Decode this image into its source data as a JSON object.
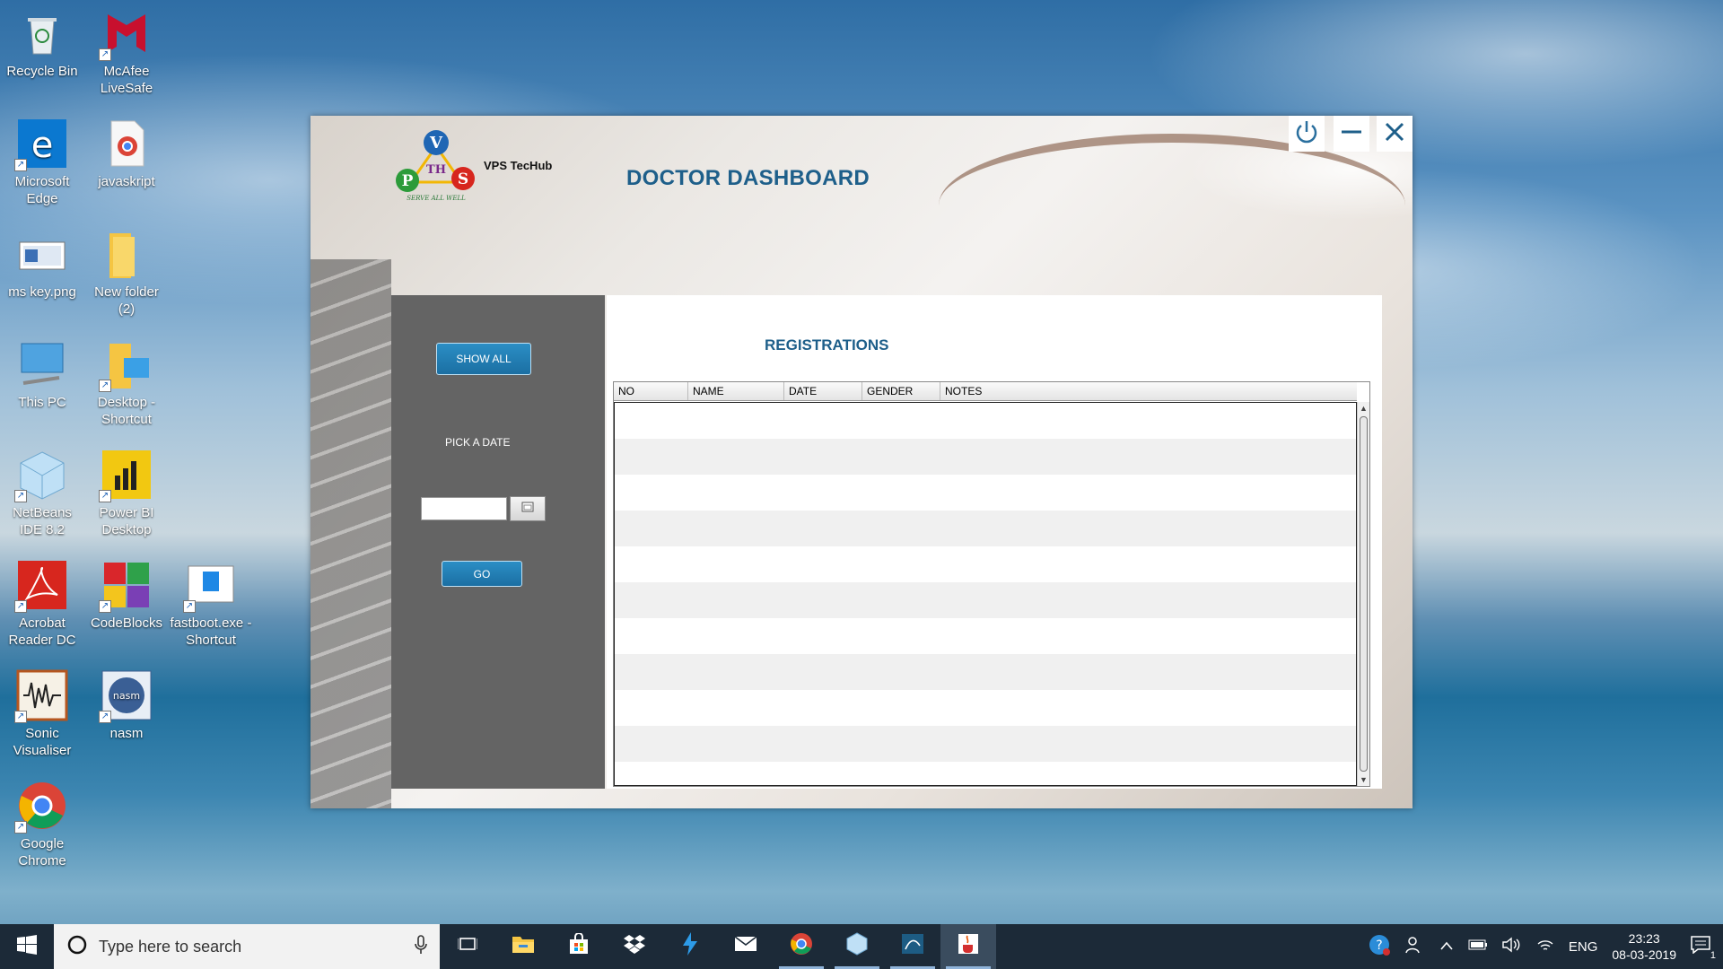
{
  "desktop": {
    "icons": [
      {
        "label": "Recycle Bin",
        "icon": "recycle-bin-icon"
      },
      {
        "label": "McAfee LiveSafe",
        "icon": "mcafee-icon"
      },
      {
        "label": "Microsoft Edge",
        "icon": "edge-icon"
      },
      {
        "label": "javaskript",
        "icon": "chrome-file-icon"
      },
      {
        "label": "ms key.png",
        "icon": "image-file-icon"
      },
      {
        "label": "New folder (2)",
        "icon": "folder-icon"
      },
      {
        "label": "This PC",
        "icon": "this-pc-icon"
      },
      {
        "label": "Desktop - Shortcut",
        "icon": "folder-shortcut-icon"
      },
      {
        "label": "NetBeans IDE 8.2",
        "icon": "netbeans-icon"
      },
      {
        "label": "Power BI Desktop",
        "icon": "powerbi-icon"
      },
      {
        "label": "Acrobat Reader DC",
        "icon": "acrobat-icon"
      },
      {
        "label": "CodeBlocks",
        "icon": "codeblocks-icon"
      },
      {
        "label": "fastboot.exe - Shortcut",
        "icon": "exe-file-icon"
      },
      {
        "label": "Sonic Visualiser",
        "icon": "sonic-visualiser-icon"
      },
      {
        "label": "nasm",
        "icon": "nasm-icon"
      },
      {
        "label": "Google Chrome",
        "icon": "chrome-icon"
      }
    ]
  },
  "app": {
    "brand": "VPS TecHub",
    "logo_tagline": "SERVE ALL WELL",
    "title": "DOCTOR DASHBOARD",
    "show_all_label": "SHOW ALL",
    "pick_date_label": "PICK A DATE",
    "date_value": "",
    "go_label": "GO",
    "registrations_title": "REGISTRATIONS",
    "table": {
      "columns": [
        "NO",
        "NAME",
        "DATE",
        "GENDER",
        "NOTES"
      ],
      "rows": []
    }
  },
  "taskbar": {
    "search_placeholder": "Type here to search",
    "language": "ENG",
    "time": "23:23",
    "date": "08-03-2019",
    "notification_count": "1"
  },
  "colors": {
    "accent": "#1b6fa3",
    "title_blue": "#1e5f8a",
    "side_panel": "#646464",
    "taskbar": "#1c2a38"
  }
}
